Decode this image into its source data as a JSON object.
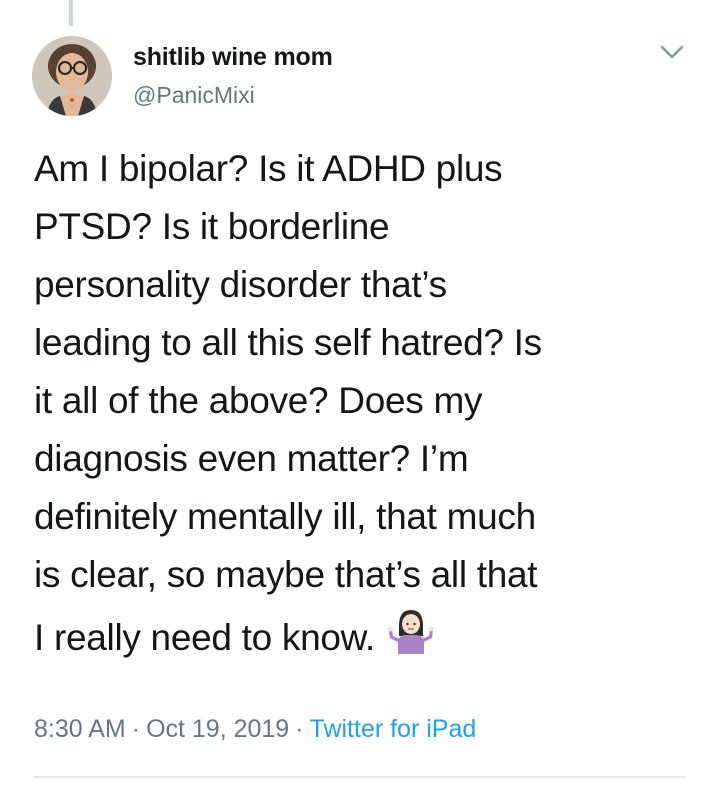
{
  "tweet": {
    "display_name": "shitlib wine mom",
    "handle": "@PanicMixi",
    "text_lines": [
      "Am I bipolar? Is it ADHD plus",
      "PTSD? Is it borderline",
      "personality disorder that’s",
      "leading to all this self hatred? Is",
      "it all of the above? Does my",
      "diagnosis even matter? I’m",
      "definitely mentally ill, that much",
      "is clear, so maybe that’s all that",
      "I really need to know."
    ],
    "emoji": "person-shrugging-emoji",
    "time": "8:30 AM",
    "date": "Oct 19, 2019",
    "separator": "·",
    "source": "Twitter for iPad"
  },
  "icons": {
    "caret": "chevron-down-icon",
    "avatar": "avatar"
  },
  "colors": {
    "text": "#14171a",
    "secondary": "#657786",
    "link": "#1da1f2",
    "divider": "#e1e8ed",
    "thread_line": "#ccd6dd"
  }
}
